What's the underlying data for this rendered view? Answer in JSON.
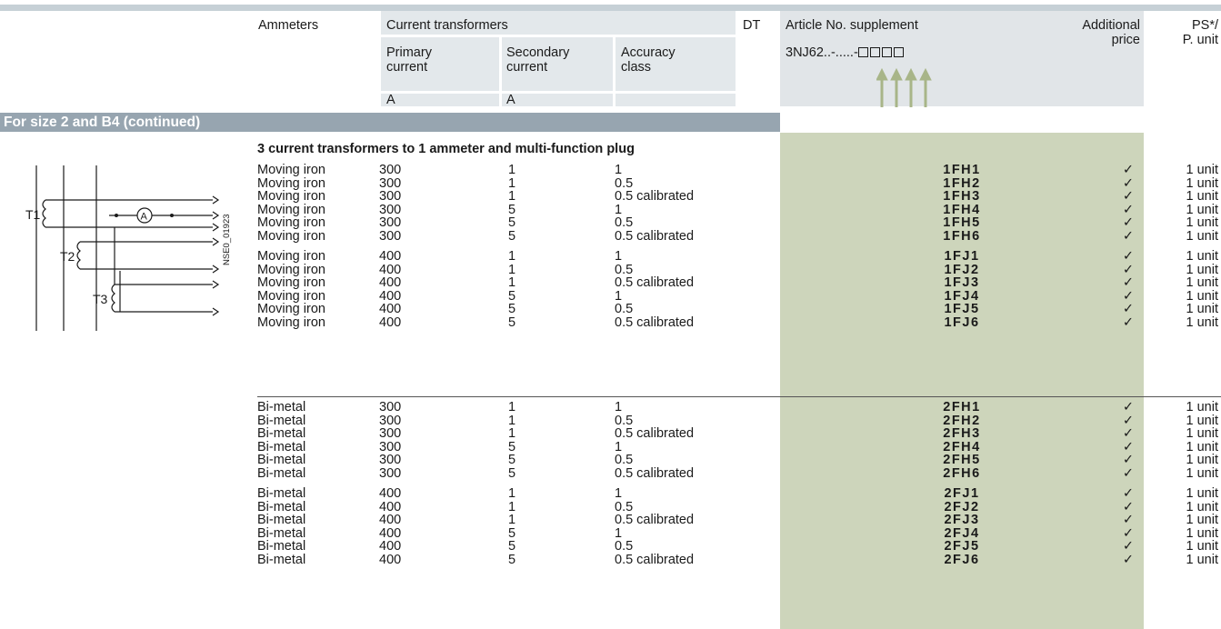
{
  "header": {
    "ammeters": "Ammeters",
    "current_transformers": "Current transformers",
    "primary_current": "Primary\ncurrent",
    "secondary_current": "Secondary\ncurrent",
    "accuracy_class": "Accuracy\nclass",
    "dt": "DT",
    "article_no_supplement": "Article No. supplement",
    "article_prefix": "3NJ62..-.....-",
    "additional_price": "Additional\nprice",
    "ps_unit": "PS*/\nP. unit",
    "unit_a_primary": "A",
    "unit_a_secondary": "A"
  },
  "section": {
    "title": "For size 2 and B4 (continued)",
    "subtitle": "3 current transformers to 1 ammeter and multi-function plug"
  },
  "diagram": {
    "labels": [
      "T1",
      "T2",
      "T3"
    ],
    "ammeter_symbol": "A",
    "code": "NSE0_01923"
  },
  "colors": {
    "band": "#97a5b0",
    "article_column": "#cdd5bb",
    "header_panel": "#e1e5e8",
    "arrow": "#a8b588"
  },
  "rows": [
    {
      "ammeter": "Moving iron",
      "primary": "300",
      "secondary": "1",
      "accuracy": "1",
      "code": "1FH1",
      "check": "✓",
      "unit": "1 unit"
    },
    {
      "ammeter": "Moving iron",
      "primary": "300",
      "secondary": "1",
      "accuracy": "0.5",
      "code": "1FH2",
      "check": "✓",
      "unit": "1 unit"
    },
    {
      "ammeter": "Moving iron",
      "primary": "300",
      "secondary": "1",
      "accuracy": "0.5 calibrated",
      "code": "1FH3",
      "check": "✓",
      "unit": "1 unit"
    },
    {
      "ammeter": "Moving iron",
      "primary": "300",
      "secondary": "5",
      "accuracy": "1",
      "code": "1FH4",
      "check": "✓",
      "unit": "1 unit"
    },
    {
      "ammeter": "Moving iron",
      "primary": "300",
      "secondary": "5",
      "accuracy": "0.5",
      "code": "1FH5",
      "check": "✓",
      "unit": "1 unit"
    },
    {
      "ammeter": "Moving iron",
      "primary": "300",
      "secondary": "5",
      "accuracy": "0.5 calibrated",
      "code": "1FH6",
      "check": "✓",
      "unit": "1 unit"
    },
    {
      "ammeter": "Moving iron",
      "primary": "400",
      "secondary": "1",
      "accuracy": "1",
      "code": "1FJ1",
      "check": "✓",
      "unit": "1 unit"
    },
    {
      "ammeter": "Moving iron",
      "primary": "400",
      "secondary": "1",
      "accuracy": "0.5",
      "code": "1FJ2",
      "check": "✓",
      "unit": "1 unit"
    },
    {
      "ammeter": "Moving iron",
      "primary": "400",
      "secondary": "1",
      "accuracy": "0.5 calibrated",
      "code": "1FJ3",
      "check": "✓",
      "unit": "1 unit"
    },
    {
      "ammeter": "Moving iron",
      "primary": "400",
      "secondary": "5",
      "accuracy": "1",
      "code": "1FJ4",
      "check": "✓",
      "unit": "1 unit"
    },
    {
      "ammeter": "Moving iron",
      "primary": "400",
      "secondary": "5",
      "accuracy": "0.5",
      "code": "1FJ5",
      "check": "✓",
      "unit": "1 unit"
    },
    {
      "ammeter": "Moving iron",
      "primary": "400",
      "secondary": "5",
      "accuracy": "0.5 calibrated",
      "code": "1FJ6",
      "check": "✓",
      "unit": "1 unit"
    },
    {
      "ammeter": "Bi-metal",
      "primary": "300",
      "secondary": "1",
      "accuracy": "1",
      "code": "2FH1",
      "check": "✓",
      "unit": "1 unit"
    },
    {
      "ammeter": "Bi-metal",
      "primary": "300",
      "secondary": "1",
      "accuracy": "0.5",
      "code": "2FH2",
      "check": "✓",
      "unit": "1 unit"
    },
    {
      "ammeter": "Bi-metal",
      "primary": "300",
      "secondary": "1",
      "accuracy": "0.5 calibrated",
      "code": "2FH3",
      "check": "✓",
      "unit": "1 unit"
    },
    {
      "ammeter": "Bi-metal",
      "primary": "300",
      "secondary": "5",
      "accuracy": "1",
      "code": "2FH4",
      "check": "✓",
      "unit": "1 unit"
    },
    {
      "ammeter": "Bi-metal",
      "primary": "300",
      "secondary": "5",
      "accuracy": "0.5",
      "code": "2FH5",
      "check": "✓",
      "unit": "1 unit"
    },
    {
      "ammeter": "Bi-metal",
      "primary": "300",
      "secondary": "5",
      "accuracy": "0.5 calibrated",
      "code": "2FH6",
      "check": "✓",
      "unit": "1 unit"
    },
    {
      "ammeter": "Bi-metal",
      "primary": "400",
      "secondary": "1",
      "accuracy": "1",
      "code": "2FJ1",
      "check": "✓",
      "unit": "1 unit"
    },
    {
      "ammeter": "Bi-metal",
      "primary": "400",
      "secondary": "1",
      "accuracy": "0.5",
      "code": "2FJ2",
      "check": "✓",
      "unit": "1 unit"
    },
    {
      "ammeter": "Bi-metal",
      "primary": "400",
      "secondary": "1",
      "accuracy": "0.5 calibrated",
      "code": "2FJ3",
      "check": "✓",
      "unit": "1 unit"
    },
    {
      "ammeter": "Bi-metal",
      "primary": "400",
      "secondary": "5",
      "accuracy": "1",
      "code": "2FJ4",
      "check": "✓",
      "unit": "1 unit"
    },
    {
      "ammeter": "Bi-metal",
      "primary": "400",
      "secondary": "5",
      "accuracy": "0.5",
      "code": "2FJ5",
      "check": "✓",
      "unit": "1 unit"
    },
    {
      "ammeter": "Bi-metal",
      "primary": "400",
      "secondary": "5",
      "accuracy": "0.5 calibrated",
      "code": "2FJ6",
      "check": "✓",
      "unit": "1 unit"
    }
  ]
}
